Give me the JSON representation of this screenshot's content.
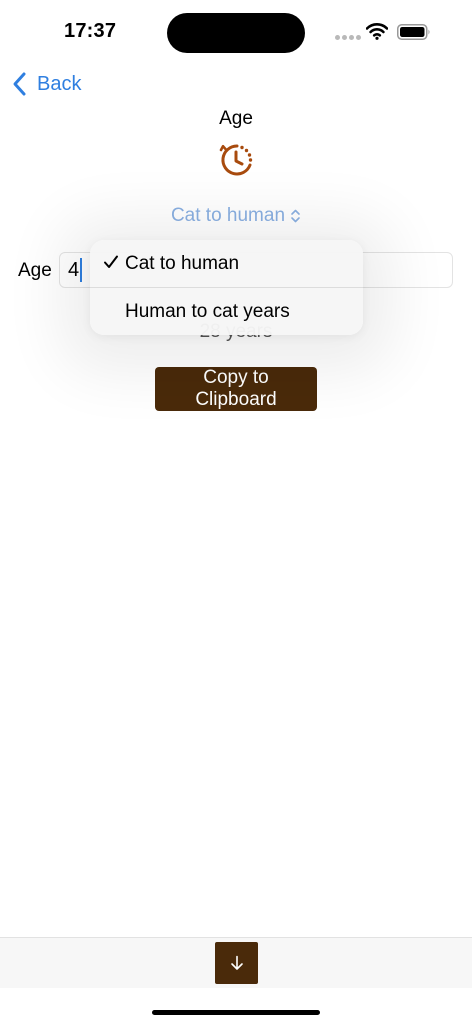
{
  "status_bar": {
    "time": "17:37",
    "icons": [
      "signal-dots-icon",
      "wifi-icon",
      "battery-icon"
    ]
  },
  "nav": {
    "back_label": "Back",
    "back_icon": "chevron-left-icon"
  },
  "header": {
    "title": "Age",
    "icon": "clock-rotate-icon"
  },
  "mode_picker": {
    "selected": "Cat to human",
    "icon": "chevron-updown-icon"
  },
  "age_input": {
    "label": "Age",
    "value": "4"
  },
  "result": {
    "text": "28 years"
  },
  "copy_button": {
    "label": "Copy to Clipboard"
  },
  "menu": {
    "items": [
      {
        "label": "Cat to human",
        "checked": true
      },
      {
        "label": "Human to cat years",
        "checked": false
      }
    ]
  },
  "toolbar": {
    "download_icon": "arrow-down-icon"
  },
  "colors": {
    "accent_blue": "#2f7fe0",
    "picker_blue": "#8ab0e2",
    "brand_brown": "#4a2a0a",
    "icon_orange": "#a84b0e"
  }
}
